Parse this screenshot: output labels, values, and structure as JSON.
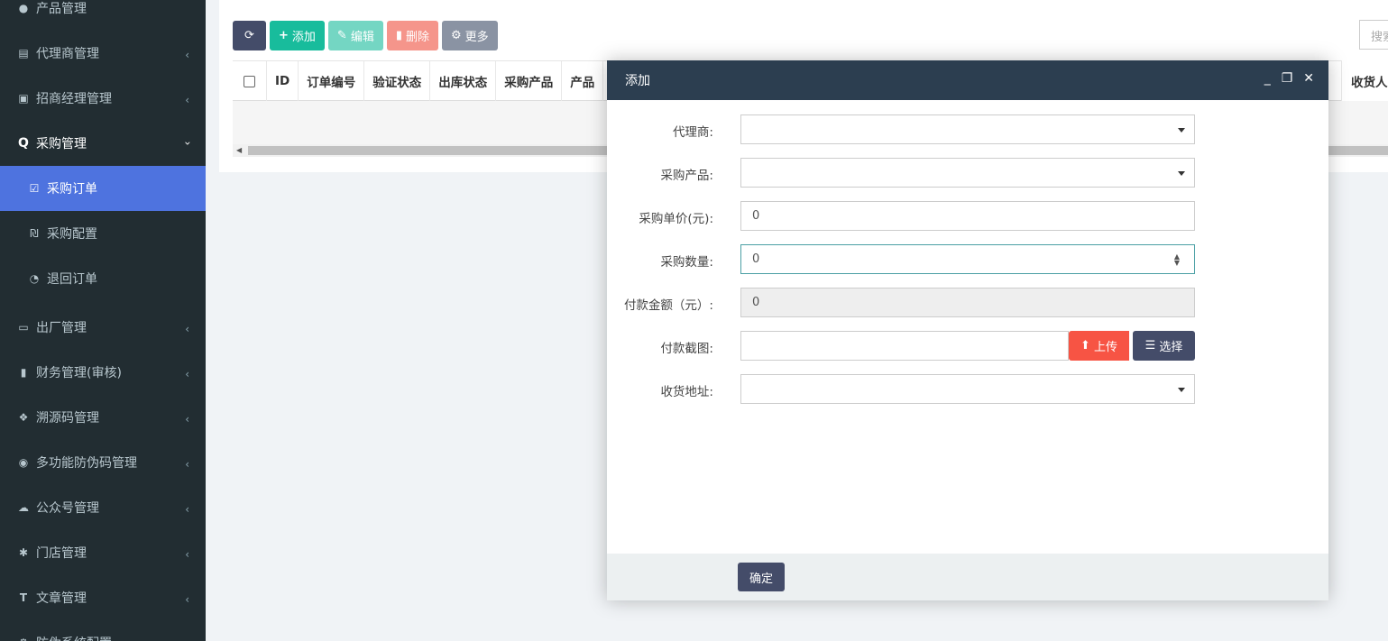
{
  "sidebar": {
    "items": [
      {
        "label": "产品管理",
        "icon": "globe-icon"
      },
      {
        "label": "代理商管理",
        "icon": "id-card-icon"
      },
      {
        "label": "招商经理管理",
        "icon": "user-box-icon"
      },
      {
        "label": "采购管理",
        "icon": "search-q-icon"
      },
      {
        "label": "出厂管理",
        "icon": "truck-icon"
      },
      {
        "label": "财务管理(审核)",
        "icon": "info-box-icon"
      },
      {
        "label": "溯源码管理",
        "icon": "cubes-icon"
      },
      {
        "label": "多功能防伪码管理",
        "icon": "accessibility-icon"
      },
      {
        "label": "公众号管理",
        "icon": "wechat-icon"
      },
      {
        "label": "门店管理",
        "icon": "asterisk-icon"
      },
      {
        "label": "文章管理",
        "icon": "text-icon"
      },
      {
        "label": "防伪系统配置",
        "icon": "cog-icon"
      }
    ],
    "sub_items": [
      {
        "label": "采购订单",
        "icon": "calendar-check-icon"
      },
      {
        "label": "采购配置",
        "icon": "shekel-icon"
      },
      {
        "label": "退回订单",
        "icon": "history-icon"
      }
    ]
  },
  "toolbar": {
    "add_label": "添加",
    "edit_label": "编辑",
    "delete_label": "删除",
    "more_label": "更多"
  },
  "search": {
    "placeholder": "搜索"
  },
  "table": {
    "columns": [
      "ID",
      "订单编号",
      "验证状态",
      "出库状态",
      "采购产品",
      "产品"
    ],
    "last_column": "收货人"
  },
  "modal": {
    "title": "添加",
    "fields": {
      "agent_label": "代理商:",
      "product_label": "采购产品:",
      "unit_price_label": "采购单价(元):",
      "unit_price_value": "0",
      "quantity_label": "采购数量:",
      "quantity_value": "0",
      "payment_label": "付款金额（元）:",
      "payment_value": "0",
      "screenshot_label": "付款截图:",
      "upload_label": "上传",
      "choose_label": "选择",
      "address_label": "收货地址:"
    },
    "confirm_label": "确定"
  },
  "colors": {
    "sidebar_bg": "#222d32",
    "active_blue": "#4e73df",
    "add_green": "#18bc9c",
    "modal_header": "#2c3e50",
    "upload_red": "#f75444",
    "dark_button": "#444c69"
  }
}
